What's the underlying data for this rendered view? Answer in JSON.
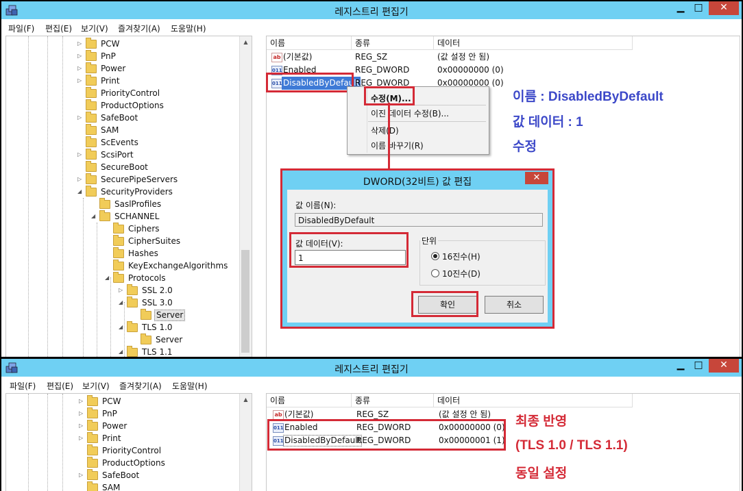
{
  "colors": {
    "titlebar": "#6fd0f3",
    "close_button": "#c7463a",
    "highlight_box": "#d42a36",
    "annotation_blue": "#3c48c8",
    "annotation_red": "#d42a36",
    "selection": "#3e7ad6"
  },
  "window_top": {
    "title": "레지스트리 편집기",
    "controls": {
      "minimize": "▁",
      "maximize": "□",
      "close": "✕"
    },
    "menu": [
      "파일(F)",
      "편집(E)",
      "보기(V)",
      "즐겨찾기(A)",
      "도움말(H)"
    ],
    "tree": [
      {
        "label": "PCW"
      },
      {
        "label": "PnP"
      },
      {
        "label": "Power"
      },
      {
        "label": "Print"
      },
      {
        "label": "PriorityControl"
      },
      {
        "label": "ProductOptions"
      },
      {
        "label": "SafeBoot"
      },
      {
        "label": "SAM"
      },
      {
        "label": "ScEvents"
      },
      {
        "label": "ScsiPort"
      },
      {
        "label": "SecureBoot"
      },
      {
        "label": "SecurePipeServers"
      },
      {
        "label": "SecurityProviders"
      },
      {
        "label": "SaslProfiles"
      },
      {
        "label": "SCHANNEL"
      },
      {
        "label": "Ciphers"
      },
      {
        "label": "CipherSuites"
      },
      {
        "label": "Hashes"
      },
      {
        "label": "KeyExchangeAlgorithms"
      },
      {
        "label": "Protocols"
      },
      {
        "label": "SSL 2.0"
      },
      {
        "label": "SSL 3.0"
      },
      {
        "label": "Server"
      },
      {
        "label": "TLS 1.0"
      },
      {
        "label": "Server"
      },
      {
        "label": "TLS 1.1"
      }
    ],
    "columns": [
      "이름",
      "종류",
      "데이터"
    ],
    "rows": [
      {
        "icon": "ab",
        "name": "(기본값)",
        "type": "REG_SZ",
        "data": "(값 설정 안 됨)"
      },
      {
        "icon": "011",
        "name": "Enabled",
        "type": "REG_DWORD",
        "data": "0x00000000 (0)"
      },
      {
        "icon": "011",
        "name": "DisabledByDefault",
        "type": "REG_DWORD",
        "data": "0x00000000 (0)"
      }
    ],
    "context_menu": [
      "수정(M)...",
      "이진 데이터 수정(B)...",
      "삭제(D)",
      "이름 바꾸기(R)"
    ],
    "dialog": {
      "title": "DWORD(32비트) 값 편집",
      "close": "✕",
      "name_label": "값 이름(N):",
      "name_value": "DisabledByDefault",
      "data_label": "값 데이터(V):",
      "data_value": "1",
      "unit_label": "단위",
      "radio_hex": "16진수(H)",
      "radio_dec": "10진수(D)",
      "ok": "확인",
      "cancel": "취소"
    },
    "annotation": [
      "이름 : DisabledByDefault",
      "값 데이터 : 1",
      "수정"
    ]
  },
  "window_bottom": {
    "title": "레지스트리 편집기",
    "controls": {
      "minimize": "▁",
      "maximize": "□",
      "close": "✕"
    },
    "menu": [
      "파일(F)",
      "편집(E)",
      "보기(V)",
      "즐겨찾기(A)",
      "도움말(H)"
    ],
    "tree": [
      {
        "label": "PCW"
      },
      {
        "label": "PnP"
      },
      {
        "label": "Power"
      },
      {
        "label": "Print"
      },
      {
        "label": "PriorityControl"
      },
      {
        "label": "ProductOptions"
      },
      {
        "label": "SafeBoot"
      },
      {
        "label": "SAM"
      }
    ],
    "columns": [
      "이름",
      "종류",
      "데이터"
    ],
    "rows": [
      {
        "icon": "ab",
        "name": "(기본값)",
        "type": "REG_SZ",
        "data": "(값 설정 안 됨)"
      },
      {
        "icon": "011",
        "name": "Enabled",
        "type": "REG_DWORD",
        "data": "0x00000000 (0)"
      },
      {
        "icon": "011",
        "name": "DisabledByDefault",
        "type": "REG_DWORD",
        "data": "0x00000001 (1)"
      }
    ],
    "annotation": [
      "최종 반영",
      "(TLS 1.0 / TLS 1.1)",
      "동일 설정"
    ]
  }
}
